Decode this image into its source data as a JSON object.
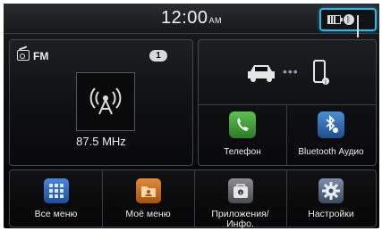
{
  "status_bar": {
    "time": "12:00",
    "ampm": "AM"
  },
  "radio": {
    "band": "FM",
    "preset_number": "1",
    "frequency": "87.5 MHz"
  },
  "connectivity": {
    "phone_label": "Телефон",
    "bt_audio_label": "Bluetooth Аудио"
  },
  "bottom_menu": {
    "all_menu_label": "Все меню",
    "my_menu_label": "Моё меню",
    "apps_label_line1": "Приложения/",
    "apps_label_line2": "Инфо.",
    "settings_label": "Настройки"
  },
  "colors": {
    "accent": "#2fb6e8",
    "phone_icon_bg": "#3f9b3a",
    "bt_icon_bg": "#2e6fb5",
    "all_menu_bg": "#2c5fae",
    "my_menu_bg": "#c56a1e",
    "apps_bg": "#6c6e72",
    "settings_bg": "#5b6c86"
  }
}
